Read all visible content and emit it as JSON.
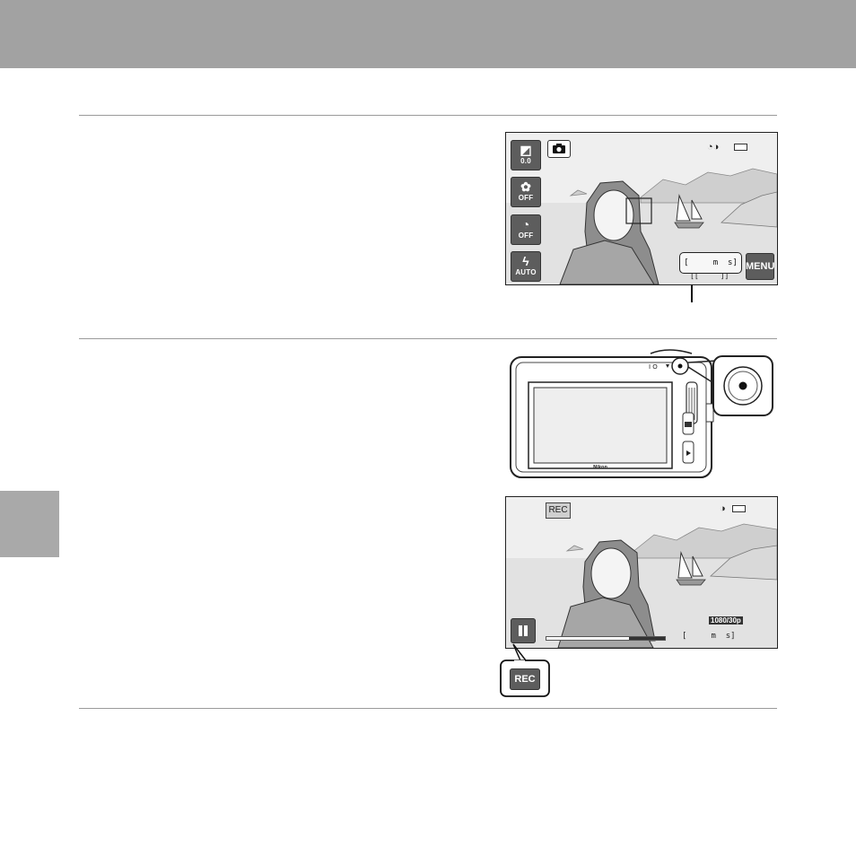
{
  "figure1": {
    "exposure_value": "0.0",
    "macro_label": "OFF",
    "self_timer_label": "OFF",
    "flash_label": "AUTO",
    "menu_label": "MENU",
    "remaining_time": "[     m  s]",
    "remaining_time_sub": "[[     ]]",
    "icons": [
      "exposure-icon",
      "macro-icon",
      "self-timer-icon",
      "flash-icon",
      "camera-mode-icon",
      "vr-icon",
      "battery-icon",
      "menu-icon"
    ]
  },
  "figure2": {
    "brand_label": "Nikon",
    "icons": [
      "movie-record-button",
      "camera-shutter-icon",
      "playback-icon"
    ]
  },
  "figure3": {
    "rec_label": "REC",
    "pause_icon": "pause-icon",
    "movie_info": "1080/30p",
    "elapsed_time": "[     m  s]",
    "callout_label": "REC",
    "progress": 0.3
  },
  "colors": {
    "header": "#a2a2a2",
    "button": "#5d5d5d",
    "rule": "#9a9a9a"
  }
}
